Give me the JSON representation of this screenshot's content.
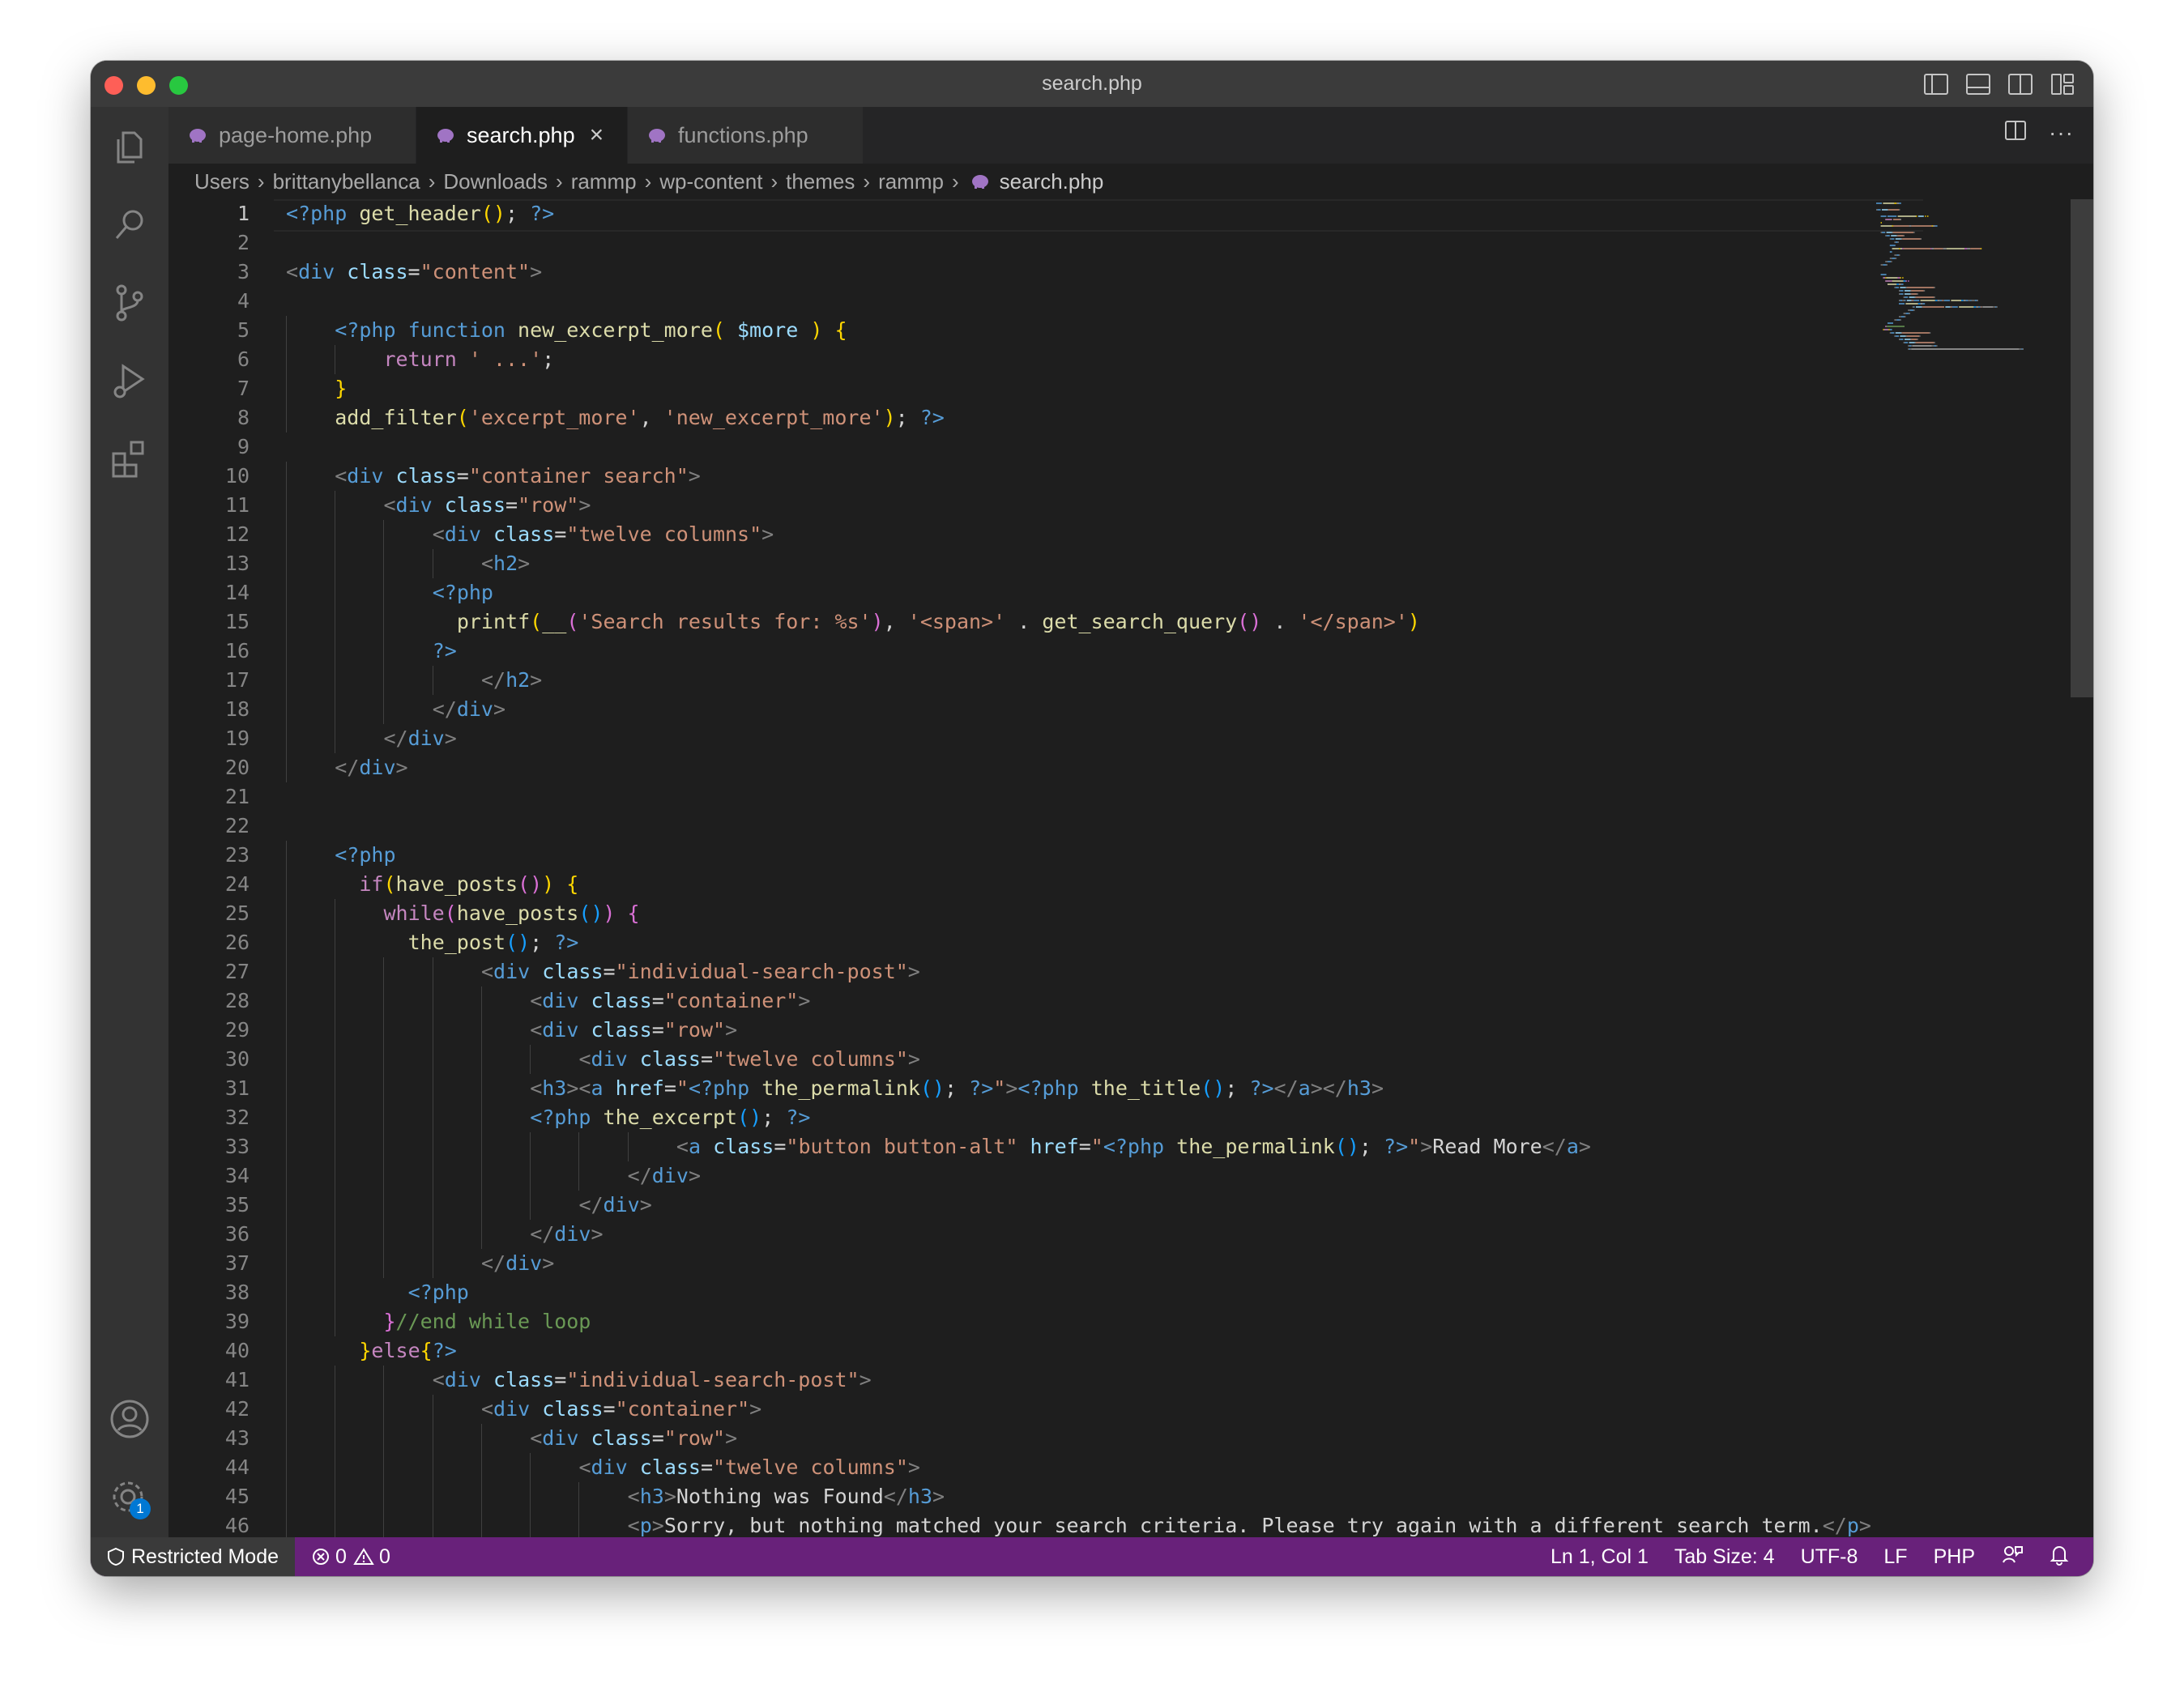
{
  "window": {
    "title": "search.php"
  },
  "tabs": [
    {
      "label": "page-home.php",
      "active": false
    },
    {
      "label": "search.php",
      "active": true
    },
    {
      "label": "functions.php",
      "active": false
    }
  ],
  "breadcrumb": [
    "Users",
    "brittanybellanca",
    "Downloads",
    "rammp",
    "wp-content",
    "themes",
    "rammp",
    "search.php"
  ],
  "editor": {
    "current_line": 1
  },
  "code_lines": [
    {
      "n": "1",
      "indent": 0,
      "tokens": [
        [
          "tg",
          "<?php"
        ],
        [
          "t",
          " "
        ],
        [
          "fn",
          "get_header"
        ],
        [
          "y",
          "()"
        ],
        [
          "t",
          "; "
        ],
        [
          "tg",
          "?>"
        ]
      ]
    },
    {
      "n": "2",
      "indent": 0,
      "tokens": []
    },
    {
      "n": "3",
      "indent": 0,
      "tokens": [
        [
          "br",
          "<"
        ],
        [
          "tag",
          "div"
        ],
        [
          "t",
          " "
        ],
        [
          "at",
          "class"
        ],
        [
          "t",
          "="
        ],
        [
          "s",
          "\"content\""
        ],
        [
          "br",
          ">"
        ]
      ]
    },
    {
      "n": "4",
      "indent": 0,
      "tokens": []
    },
    {
      "n": "5",
      "indent": 1,
      "tokens": [
        [
          "tg",
          "<?php"
        ],
        [
          "t",
          " "
        ],
        [
          "k2",
          "function"
        ],
        [
          "t",
          " "
        ],
        [
          "fn",
          "new_excerpt_more"
        ],
        [
          "y",
          "("
        ],
        [
          "t",
          " "
        ],
        [
          "v",
          "$more"
        ],
        [
          "t",
          " "
        ],
        [
          "y",
          ")"
        ],
        [
          "t",
          " "
        ],
        [
          "y",
          "{"
        ]
      ]
    },
    {
      "n": "6",
      "indent": 2,
      "tokens": [
        [
          "kw",
          "return"
        ],
        [
          "t",
          " "
        ],
        [
          "s",
          "' ...'"
        ],
        [
          "t",
          ";"
        ]
      ]
    },
    {
      "n": "7",
      "indent": 1,
      "tokens": [
        [
          "y",
          "}"
        ]
      ]
    },
    {
      "n": "8",
      "indent": 1,
      "tokens": [
        [
          "fn",
          "add_filter"
        ],
        [
          "y",
          "("
        ],
        [
          "s",
          "'excerpt_more'"
        ],
        [
          "t",
          ", "
        ],
        [
          "s",
          "'new_excerpt_more'"
        ],
        [
          "y",
          ")"
        ],
        [
          "t",
          "; "
        ],
        [
          "tg",
          "?>"
        ]
      ]
    },
    {
      "n": "9",
      "indent": 0,
      "tokens": []
    },
    {
      "n": "10",
      "indent": 1,
      "tokens": [
        [
          "br",
          "<"
        ],
        [
          "tag",
          "div"
        ],
        [
          "t",
          " "
        ],
        [
          "at",
          "class"
        ],
        [
          "t",
          "="
        ],
        [
          "s",
          "\"container search\""
        ],
        [
          "br",
          ">"
        ]
      ]
    },
    {
      "n": "11",
      "indent": 2,
      "tokens": [
        [
          "br",
          "<"
        ],
        [
          "tag",
          "div"
        ],
        [
          "t",
          " "
        ],
        [
          "at",
          "class"
        ],
        [
          "t",
          "="
        ],
        [
          "s",
          "\"row\""
        ],
        [
          "br",
          ">"
        ]
      ]
    },
    {
      "n": "12",
      "indent": 3,
      "tokens": [
        [
          "br",
          "<"
        ],
        [
          "tag",
          "div"
        ],
        [
          "t",
          " "
        ],
        [
          "at",
          "class"
        ],
        [
          "t",
          "="
        ],
        [
          "s",
          "\"twelve columns\""
        ],
        [
          "br",
          ">"
        ]
      ]
    },
    {
      "n": "13",
      "indent": 4,
      "tokens": [
        [
          "br",
          "<"
        ],
        [
          "tag",
          "h2"
        ],
        [
          "br",
          ">"
        ]
      ]
    },
    {
      "n": "14",
      "indent": 3,
      "tokens": [
        [
          "tg",
          "<?php"
        ]
      ]
    },
    {
      "n": "15",
      "indent": 3.5,
      "tokens": [
        [
          "fn",
          "printf"
        ],
        [
          "y",
          "("
        ],
        [
          "fn",
          "__"
        ],
        [
          "m",
          "("
        ],
        [
          "s",
          "'Search results for: %s'"
        ],
        [
          "m",
          ")"
        ],
        [
          "t",
          ", "
        ],
        [
          "s",
          "'<span>'"
        ],
        [
          "t",
          " . "
        ],
        [
          "fn",
          "get_search_query"
        ],
        [
          "m",
          "()"
        ],
        [
          "t",
          " . "
        ],
        [
          "s",
          "'</span>'"
        ],
        [
          "y",
          ")"
        ]
      ]
    },
    {
      "n": "16",
      "indent": 3,
      "tokens": [
        [
          "tg",
          "?>"
        ]
      ]
    },
    {
      "n": "17",
      "indent": 4,
      "tokens": [
        [
          "br",
          "</"
        ],
        [
          "tag",
          "h2"
        ],
        [
          "br",
          ">"
        ]
      ]
    },
    {
      "n": "18",
      "indent": 3,
      "tokens": [
        [
          "br",
          "</"
        ],
        [
          "tag",
          "div"
        ],
        [
          "br",
          ">"
        ]
      ]
    },
    {
      "n": "19",
      "indent": 2,
      "tokens": [
        [
          "br",
          "</"
        ],
        [
          "tag",
          "div"
        ],
        [
          "br",
          ">"
        ]
      ]
    },
    {
      "n": "20",
      "indent": 1,
      "tokens": [
        [
          "br",
          "</"
        ],
        [
          "tag",
          "div"
        ],
        [
          "br",
          ">"
        ]
      ]
    },
    {
      "n": "21",
      "indent": 0,
      "tokens": []
    },
    {
      "n": "22",
      "indent": 0,
      "tokens": []
    },
    {
      "n": "23",
      "indent": 1,
      "tokens": [
        [
          "tg",
          "<?php"
        ]
      ]
    },
    {
      "n": "24",
      "indent": 1.5,
      "tokens": [
        [
          "kw",
          "if"
        ],
        [
          "y",
          "("
        ],
        [
          "fn",
          "have_posts"
        ],
        [
          "m",
          "()"
        ],
        [
          "y",
          ")"
        ],
        [
          "t",
          " "
        ],
        [
          "y",
          "{"
        ]
      ]
    },
    {
      "n": "25",
      "indent": 2,
      "tokens": [
        [
          "kw",
          "while"
        ],
        [
          "m",
          "("
        ],
        [
          "fn",
          "have_posts"
        ],
        [
          "b",
          "()"
        ],
        [
          "m",
          ")"
        ],
        [
          "t",
          " "
        ],
        [
          "m",
          "{"
        ]
      ]
    },
    {
      "n": "26",
      "indent": 2.5,
      "tokens": [
        [
          "fn",
          "the_post"
        ],
        [
          "b",
          "()"
        ],
        [
          "t",
          "; "
        ],
        [
          "tg",
          "?>"
        ]
      ]
    },
    {
      "n": "27",
      "indent": 4,
      "tokens": [
        [
          "br",
          "<"
        ],
        [
          "tag",
          "div"
        ],
        [
          "t",
          " "
        ],
        [
          "at",
          "class"
        ],
        [
          "t",
          "="
        ],
        [
          "s",
          "\"individual-search-post\""
        ],
        [
          "br",
          ">"
        ]
      ]
    },
    {
      "n": "28",
      "indent": 5,
      "tokens": [
        [
          "br",
          "<"
        ],
        [
          "tag",
          "div"
        ],
        [
          "t",
          " "
        ],
        [
          "at",
          "class"
        ],
        [
          "t",
          "="
        ],
        [
          "s",
          "\"container\""
        ],
        [
          "br",
          ">"
        ]
      ]
    },
    {
      "n": "29",
      "indent": 5,
      "tokens": [
        [
          "br",
          "<"
        ],
        [
          "tag",
          "div"
        ],
        [
          "t",
          " "
        ],
        [
          "at",
          "class"
        ],
        [
          "t",
          "="
        ],
        [
          "s",
          "\"row\""
        ],
        [
          "br",
          ">"
        ]
      ]
    },
    {
      "n": "30",
      "indent": 6,
      "tokens": [
        [
          "br",
          "<"
        ],
        [
          "tag",
          "div"
        ],
        [
          "t",
          " "
        ],
        [
          "at",
          "class"
        ],
        [
          "t",
          "="
        ],
        [
          "s",
          "\"twelve columns\""
        ],
        [
          "br",
          ">"
        ]
      ]
    },
    {
      "n": "31",
      "indent": 5,
      "tokens": [
        [
          "br",
          "<"
        ],
        [
          "tag",
          "h3"
        ],
        [
          "br",
          "><"
        ],
        [
          "tag",
          "a"
        ],
        [
          "t",
          " "
        ],
        [
          "at",
          "href"
        ],
        [
          "t",
          "="
        ],
        [
          "s",
          "\""
        ],
        [
          "tg",
          "<?php"
        ],
        [
          "t",
          " "
        ],
        [
          "fn",
          "the_permalink"
        ],
        [
          "b",
          "()"
        ],
        [
          "t",
          "; "
        ],
        [
          "tg",
          "?>"
        ],
        [
          "s",
          "\""
        ],
        [
          "br",
          ">"
        ],
        [
          "tg",
          "<?php"
        ],
        [
          "t",
          " "
        ],
        [
          "fn",
          "the_title"
        ],
        [
          "b",
          "()"
        ],
        [
          "t",
          "; "
        ],
        [
          "tg",
          "?>"
        ],
        [
          "br",
          "</"
        ],
        [
          "tag",
          "a"
        ],
        [
          "br",
          "></"
        ],
        [
          "tag",
          "h3"
        ],
        [
          "br",
          ">"
        ]
      ]
    },
    {
      "n": "32",
      "indent": 5,
      "tokens": [
        [
          "tg",
          "<?php"
        ],
        [
          "t",
          " "
        ],
        [
          "fn",
          "the_excerpt"
        ],
        [
          "b",
          "()"
        ],
        [
          "t",
          "; "
        ],
        [
          "tg",
          "?>"
        ]
      ]
    },
    {
      "n": "33",
      "indent": 8,
      "tokens": [
        [
          "br",
          "<"
        ],
        [
          "tag",
          "a"
        ],
        [
          "t",
          " "
        ],
        [
          "at",
          "class"
        ],
        [
          "t",
          "="
        ],
        [
          "s",
          "\"button button-alt\""
        ],
        [
          "t",
          " "
        ],
        [
          "at",
          "href"
        ],
        [
          "t",
          "="
        ],
        [
          "s",
          "\""
        ],
        [
          "tg",
          "<?php"
        ],
        [
          "t",
          " "
        ],
        [
          "fn",
          "the_permalink"
        ],
        [
          "b",
          "()"
        ],
        [
          "t",
          "; "
        ],
        [
          "tg",
          "?>"
        ],
        [
          "s",
          "\""
        ],
        [
          "br",
          ">"
        ],
        [
          "t",
          "Read More"
        ],
        [
          "br",
          "</"
        ],
        [
          "tag",
          "a"
        ],
        [
          "br",
          ">"
        ]
      ]
    },
    {
      "n": "34",
      "indent": 7,
      "tokens": [
        [
          "br",
          "</"
        ],
        [
          "tag",
          "div"
        ],
        [
          "br",
          ">"
        ]
      ]
    },
    {
      "n": "35",
      "indent": 6,
      "tokens": [
        [
          "br",
          "</"
        ],
        [
          "tag",
          "div"
        ],
        [
          "br",
          ">"
        ]
      ]
    },
    {
      "n": "36",
      "indent": 5,
      "tokens": [
        [
          "br",
          "</"
        ],
        [
          "tag",
          "div"
        ],
        [
          "br",
          ">"
        ]
      ]
    },
    {
      "n": "37",
      "indent": 4,
      "tokens": [
        [
          "br",
          "</"
        ],
        [
          "tag",
          "div"
        ],
        [
          "br",
          ">"
        ]
      ]
    },
    {
      "n": "38",
      "indent": 2.5,
      "tokens": [
        [
          "tg",
          "<?php"
        ]
      ]
    },
    {
      "n": "39",
      "indent": 2,
      "tokens": [
        [
          "m",
          "}"
        ],
        [
          "c",
          "//end while loop"
        ]
      ]
    },
    {
      "n": "40",
      "indent": 1.5,
      "tokens": [
        [
          "y",
          "}"
        ],
        [
          "kw",
          "else"
        ],
        [
          "y",
          "{"
        ],
        [
          "tg",
          "?>"
        ]
      ]
    },
    {
      "n": "41",
      "indent": 3,
      "tokens": [
        [
          "br",
          "<"
        ],
        [
          "tag",
          "div"
        ],
        [
          "t",
          " "
        ],
        [
          "at",
          "class"
        ],
        [
          "t",
          "="
        ],
        [
          "s",
          "\"individual-search-post\""
        ],
        [
          "br",
          ">"
        ]
      ]
    },
    {
      "n": "42",
      "indent": 4,
      "tokens": [
        [
          "br",
          "<"
        ],
        [
          "tag",
          "div"
        ],
        [
          "t",
          " "
        ],
        [
          "at",
          "class"
        ],
        [
          "t",
          "="
        ],
        [
          "s",
          "\"container\""
        ],
        [
          "br",
          ">"
        ]
      ]
    },
    {
      "n": "43",
      "indent": 5,
      "tokens": [
        [
          "br",
          "<"
        ],
        [
          "tag",
          "div"
        ],
        [
          "t",
          " "
        ],
        [
          "at",
          "class"
        ],
        [
          "t",
          "="
        ],
        [
          "s",
          "\"row\""
        ],
        [
          "br",
          ">"
        ]
      ]
    },
    {
      "n": "44",
      "indent": 6,
      "tokens": [
        [
          "br",
          "<"
        ],
        [
          "tag",
          "div"
        ],
        [
          "t",
          " "
        ],
        [
          "at",
          "class"
        ],
        [
          "t",
          "="
        ],
        [
          "s",
          "\"twelve columns\""
        ],
        [
          "br",
          ">"
        ]
      ]
    },
    {
      "n": "45",
      "indent": 7,
      "tokens": [
        [
          "br",
          "<"
        ],
        [
          "tag",
          "h3"
        ],
        [
          "br",
          ">"
        ],
        [
          "t",
          "Nothing was Found"
        ],
        [
          "br",
          "</"
        ],
        [
          "tag",
          "h3"
        ],
        [
          "br",
          ">"
        ]
      ]
    },
    {
      "n": "46",
      "indent": 7,
      "tokens": [
        [
          "br",
          "<"
        ],
        [
          "tag",
          "p"
        ],
        [
          "br",
          ">"
        ],
        [
          "t",
          "Sorry, but nothing matched your search criteria. Please try again with a different search term."
        ],
        [
          "br",
          "</"
        ],
        [
          "tag",
          "p"
        ],
        [
          "br",
          ">"
        ]
      ]
    }
  ],
  "status": {
    "restricted": "Restricted Mode",
    "errors": "0",
    "warnings": "0",
    "position": "Ln 1, Col 1",
    "tab_size": "Tab Size: 4",
    "encoding": "UTF-8",
    "eol": "LF",
    "language": "PHP"
  },
  "accounts_badge": "1",
  "colors": {
    "status_bar": "#68217a",
    "editor_bg": "#1e1e1e",
    "activity_bar": "#333333"
  }
}
